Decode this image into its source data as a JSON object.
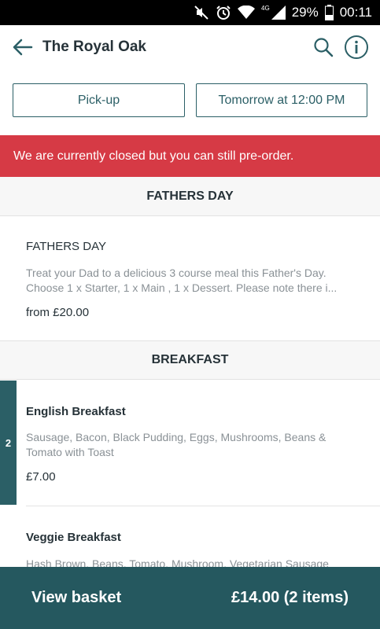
{
  "status_bar": {
    "battery": "29%",
    "time": "00:11",
    "network": "4G"
  },
  "header": {
    "title": "The Royal Oak"
  },
  "order_options": {
    "mode": "Pick-up",
    "time": "Tomorrow at 12:00 PM"
  },
  "banner": {
    "message": "We are currently closed but you can still pre-order."
  },
  "sections": [
    {
      "title": "FATHERS DAY",
      "items": [
        {
          "name": "FATHERS DAY",
          "description": "Treat your Dad to a delicious 3 course meal this Father's Day. Choose 1 x Starter, 1 x Main , 1 x Dessert. Please note there i...",
          "price": "from £20.00"
        }
      ]
    },
    {
      "title": "BREAKFAST",
      "items": [
        {
          "name": "English Breakfast",
          "description": "Sausage, Bacon, Black Pudding, Eggs, Mushrooms, Beans & Tomato with Toast",
          "price": "£7.00",
          "quantity": "2"
        },
        {
          "name": "Veggie Breakfast",
          "description": "Hash Brown, Beans, Tomato, Mushroom, Vegetarian Sausage"
        }
      ]
    }
  ],
  "basket": {
    "label": "View basket",
    "total": "£14.00 (2 items)"
  },
  "colors": {
    "accent": "#2b5f66",
    "banner": "#d63a45",
    "basket_bar": "#25585f"
  }
}
